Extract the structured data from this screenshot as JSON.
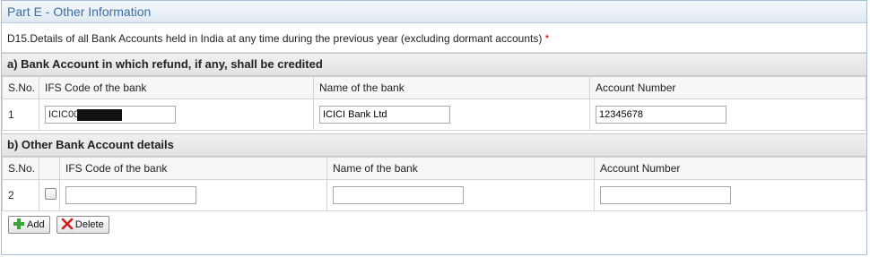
{
  "panel": {
    "title": "Part E - Other Information"
  },
  "question": {
    "text": "D15.Details of all Bank Accounts held in India at any time during the previous year (excluding dormant accounts)",
    "required_marker": "*"
  },
  "section_a": {
    "title": "a) Bank Account in which refund, if any, shall be credited",
    "columns": [
      "S.No.",
      "IFS Code of the bank",
      "Name of the bank",
      "Account Number"
    ],
    "row": {
      "sno": "1",
      "ifs_code": "ICIC00",
      "bank_name": "ICICI Bank Ltd",
      "account_number": "12345678"
    }
  },
  "section_b": {
    "title": "b) Other Bank Account details",
    "columns": [
      "S.No.",
      "IFS Code of the bank",
      "Name of the bank",
      "Account Number"
    ],
    "row": {
      "sno": "2",
      "ifs_code": "",
      "bank_name": "",
      "account_number": ""
    }
  },
  "buttons": {
    "add": "Add",
    "delete": "Delete"
  },
  "colors": {
    "accent": "#3a6ea5",
    "required": "#dd0000",
    "add_icon": "#3aa63a",
    "delete_icon": "#d21e1e"
  },
  "icons": {
    "add": "plus-icon",
    "delete": "x-icon"
  }
}
